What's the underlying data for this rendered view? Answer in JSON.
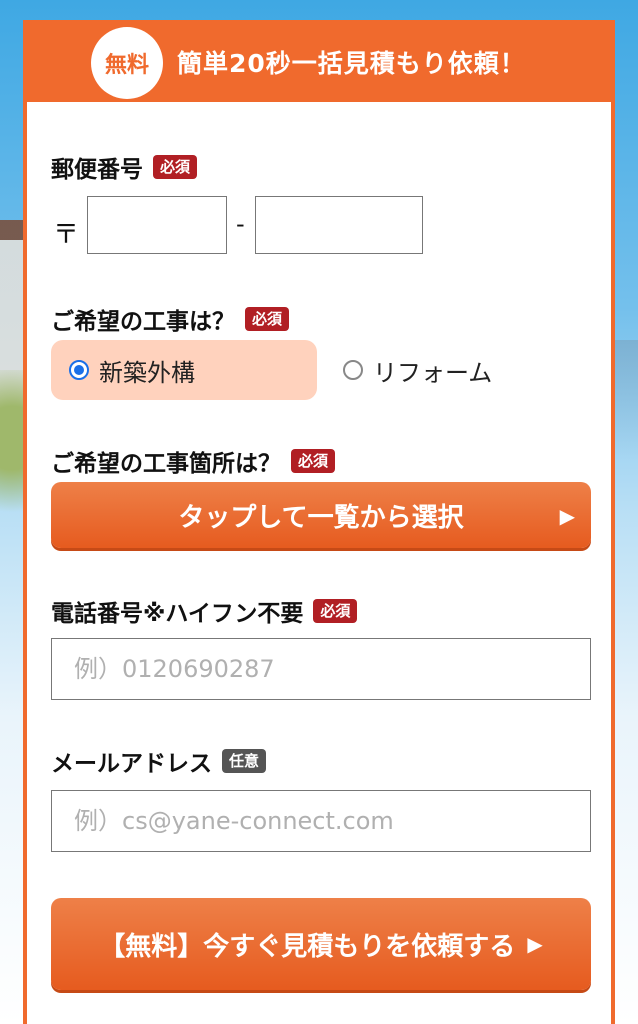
{
  "header": {
    "badge": "無料",
    "title": "簡単20秒一括見積もり依頼！"
  },
  "postal": {
    "label": "郵便番号",
    "tag": "必須",
    "mark": "〒",
    "dash": "-",
    "part1": "",
    "part2": ""
  },
  "work_type": {
    "label": "ご希望の工事は？",
    "tag": "必須",
    "options": [
      {
        "label": "新築外構",
        "selected": true
      },
      {
        "label": "リフォーム",
        "selected": false
      }
    ]
  },
  "work_location": {
    "label": "ご希望の工事箇所は？",
    "tag": "必須",
    "button_label": "タップして一覧から選択",
    "button_icon": "▶"
  },
  "phone": {
    "label": "電話番号※ハイフン不要",
    "tag": "必須",
    "placeholder": "例）0120690287"
  },
  "email": {
    "label": "メールアドレス",
    "tag": "任意",
    "placeholder": "例）cs@yane-connect.com"
  },
  "submit": {
    "label": "【無料】今すぐ見積もりを依頼する",
    "icon": "▶"
  },
  "colors": {
    "accent": "#f06a2d",
    "required": "#b11f24",
    "optional": "#555555",
    "selected_bg": "#ffd2bd",
    "radio": "#1a6fe8"
  }
}
